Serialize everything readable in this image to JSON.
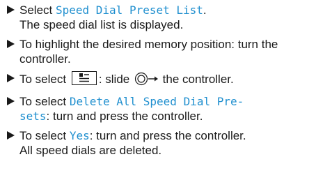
{
  "steps": [
    {
      "pre": "Select ",
      "hl": "Speed Dial Preset List",
      "post": ".",
      "result": "The speed dial list is displayed."
    },
    {
      "text": "To highlight the desired memory position: turn the controller."
    },
    {
      "pre": "To select ",
      "mid": ": slide ",
      "post": " the controller.",
      "button_icon": "list-menu-icon",
      "controller_icon": "controller-slide-right-icon"
    },
    {
      "pre": "To select ",
      "hl_line1": "Delete All Speed Dial Pre-",
      "hl_line2": "sets",
      "post": ": turn and press the controller."
    },
    {
      "pre": "To select ",
      "hl": "Yes",
      "post": ": turn and press the controller.",
      "result": "All speed dials are deleted."
    }
  ],
  "colors": {
    "highlight": "#1f8fcf",
    "text": "#1a1a1a"
  }
}
